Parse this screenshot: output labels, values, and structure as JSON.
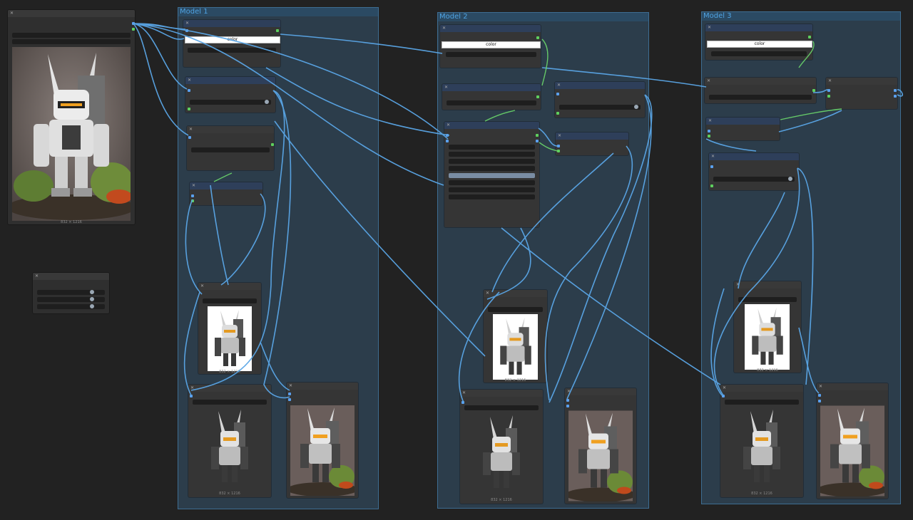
{
  "groups": [
    {
      "title": "Model 1"
    },
    {
      "title": "Model 2"
    },
    {
      "title": "Model 3"
    }
  ],
  "widgets": {
    "color_label": "color"
  },
  "captions": {
    "source_size": "832 × 1216",
    "size_label": "832 × 1216"
  },
  "icons": {
    "close": "close-icon",
    "robot": "robot-thumbnail"
  },
  "colors": {
    "canvas": "#222222",
    "group_fill": "#30485c",
    "group_border": "#3e6d92",
    "group_title": "#4fa3e2",
    "wire": "#5aa6e6",
    "wire_green": "#6bd86b",
    "node": "#353535"
  }
}
